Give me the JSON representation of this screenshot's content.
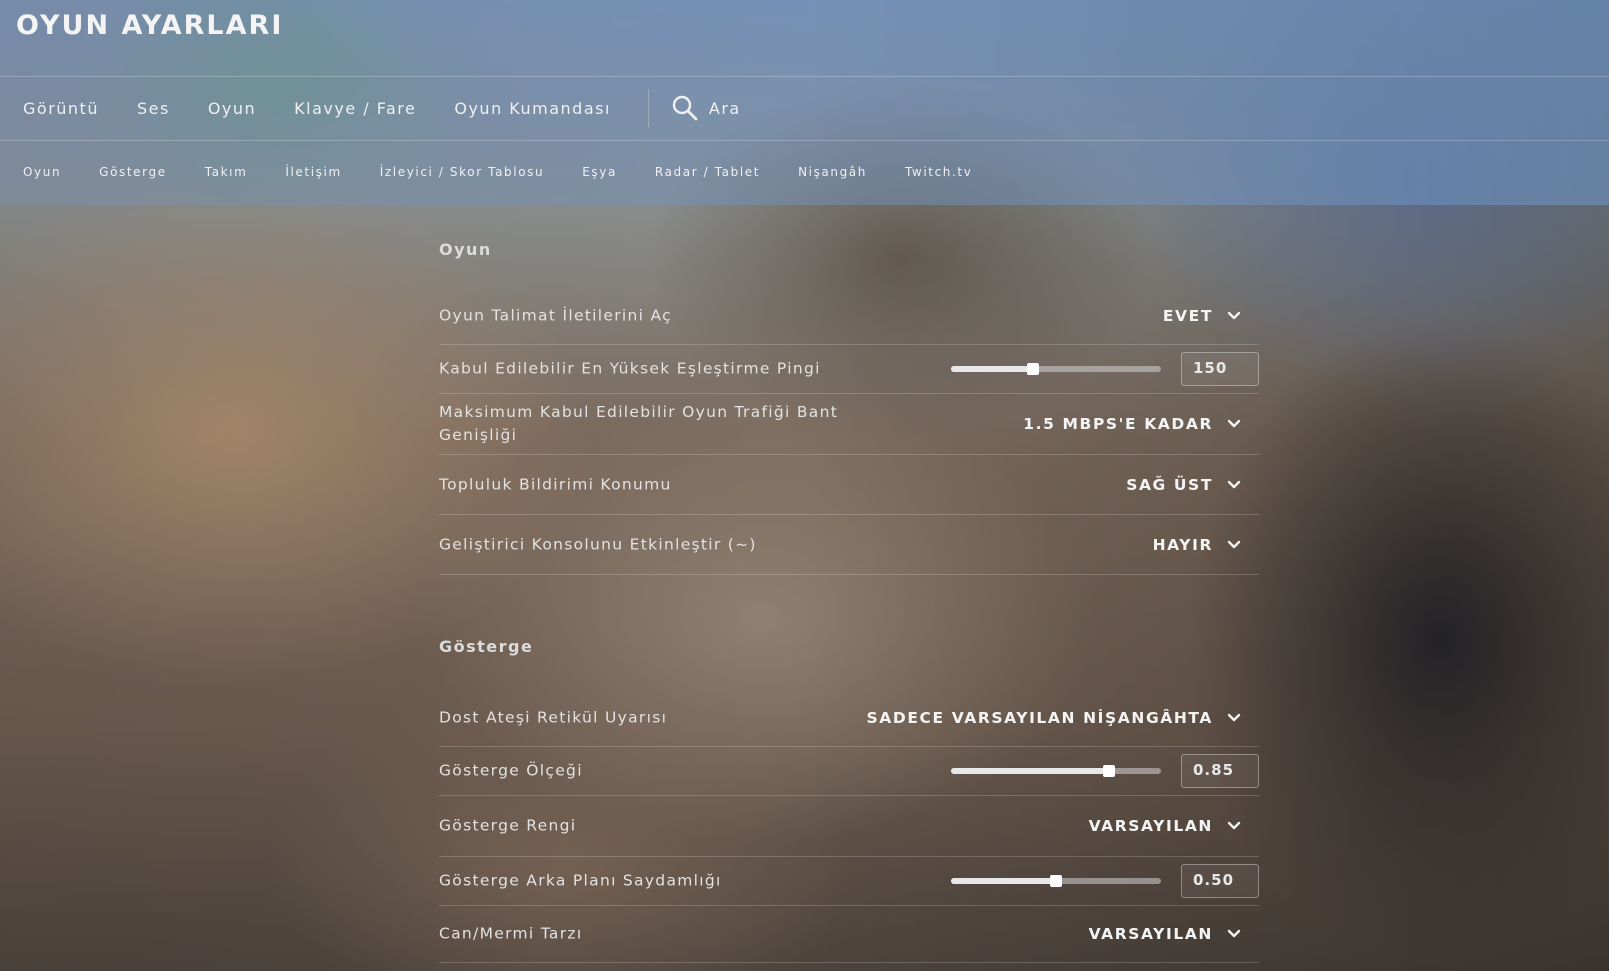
{
  "window": {
    "title": "OYUN AYARLARI"
  },
  "main_nav": {
    "items": [
      "Görüntü",
      "Ses",
      "Oyun",
      "Klavye / Fare",
      "Oyun Kumandası"
    ],
    "search_label": "Ara"
  },
  "sub_nav": {
    "items": [
      "Oyun",
      "Gösterge",
      "Takım",
      "İletişim",
      "İzleyici / Skor Tablosu",
      "Eşya",
      "Radar / Tablet",
      "Nişangâh",
      "Twitch.tv"
    ]
  },
  "sections": [
    {
      "title": "Oyun",
      "rows": [
        {
          "label": "Oyun Talimat İletilerini Aç",
          "type": "dropdown",
          "value": "EVET"
        },
        {
          "label": "Kabul Edilebilir En Yüksek Eşleştirme Pingi",
          "type": "slider",
          "value": "150",
          "fraction": 0.39
        },
        {
          "label": "Maksimum Kabul Edilebilir Oyun Trafiği Bant Genişliği",
          "type": "dropdown",
          "value": "1.5 MBPS'E KADAR"
        },
        {
          "label": "Topluluk Bildirimi Konumu",
          "type": "dropdown",
          "value": "SAĞ ÜST"
        },
        {
          "label": "Geliştirici Konsolunu Etkinleştir (~)",
          "type": "dropdown",
          "value": "HAYIR"
        }
      ]
    },
    {
      "title": "Gösterge",
      "rows": [
        {
          "label": "Dost Ateşi Retikül Uyarısı",
          "type": "dropdown",
          "value": "SADECE VARSAYILAN NİŞANGÂHTA"
        },
        {
          "label": "Gösterge Ölçeği",
          "type": "slider",
          "value": "0.85",
          "fraction": 0.75
        },
        {
          "label": "Gösterge Rengi",
          "type": "dropdown",
          "value": "VARSAYILAN"
        },
        {
          "label": "Gösterge Arka Planı Saydamlığı",
          "type": "slider",
          "value": "0.50",
          "fraction": 0.5
        },
        {
          "label": "Can/Mermi Tarzı",
          "type": "dropdown",
          "value": "VARSAYILAN"
        }
      ]
    }
  ],
  "colors": {
    "text": "#f0f0f0",
    "label": "#e2e2e2",
    "divider": "rgba(255,255,255,0.18)"
  }
}
